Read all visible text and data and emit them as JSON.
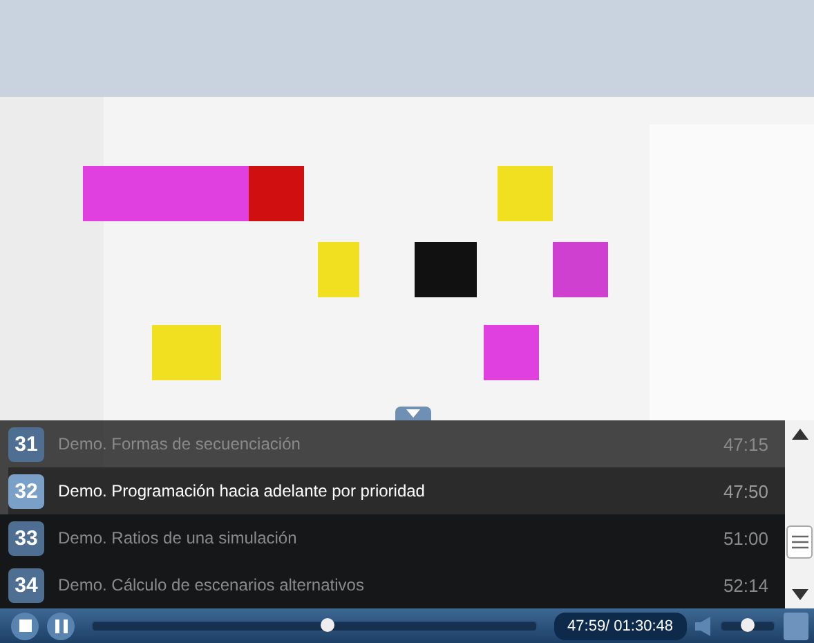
{
  "playlist": {
    "items": [
      {
        "number": "31",
        "title": "Demo. Formas de secuenciación",
        "duration": "47:15",
        "selected": false
      },
      {
        "number": "32",
        "title": "Demo. Programación hacia adelante por prioridad",
        "duration": "47:50",
        "selected": true
      },
      {
        "number": "33",
        "title": "Demo. Ratios de una simulación",
        "duration": "51:00",
        "selected": false
      },
      {
        "number": "34",
        "title": "Demo. Cálculo de escenarios alternativos",
        "duration": "52:14",
        "selected": false
      }
    ]
  },
  "controls": {
    "progress": {
      "level": 0.53
    },
    "time": "47:59/ 01:30:48",
    "volume": {
      "level": 0.5
    }
  }
}
